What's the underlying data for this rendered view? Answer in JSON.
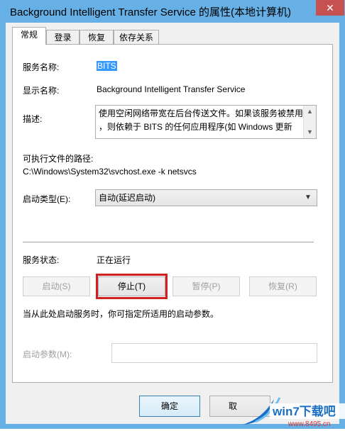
{
  "window": {
    "title": "Background Intelligent Transfer Service 的属性(本地计算机)",
    "close_glyph": "✕"
  },
  "tabs": [
    {
      "label": "常规",
      "active": true
    },
    {
      "label": "登录",
      "active": false
    },
    {
      "label": "恢复",
      "active": false
    },
    {
      "label": "依存关系",
      "active": false
    }
  ],
  "general": {
    "service_name_label": "服务名称:",
    "service_name_value": "BITS",
    "display_name_label": "显示名称:",
    "display_name_value": "Background Intelligent Transfer Service",
    "description_label": "描述:",
    "description_line1": "使用空闲网络带宽在后台传送文件。如果该服务被禁用",
    "description_line2": "，则依赖于 BITS 的任何应用程序(如 Windows 更新",
    "exe_path_label": "可执行文件的路径:",
    "exe_path_value": "C:\\Windows\\System32\\svchost.exe -k netsvcs",
    "startup_type_label": "启动类型(E):",
    "startup_type_value": "自动(延迟启动)",
    "service_status_label": "服务状态:",
    "service_status_value": "正在运行",
    "start_button": "启动(S)",
    "stop_button": "停止(T)",
    "pause_button": "暂停(P)",
    "resume_button": "恢复(R)",
    "hint_text": "当从此处启动服务时，你可指定所适用的启动参数。",
    "start_params_label": "启动参数(M):",
    "start_params_value": ""
  },
  "footer": {
    "ok_button": "确定",
    "cancel_button": "取"
  },
  "watermark": {
    "brand_text": "win7下载吧",
    "url_text": "www.8495.cn"
  }
}
